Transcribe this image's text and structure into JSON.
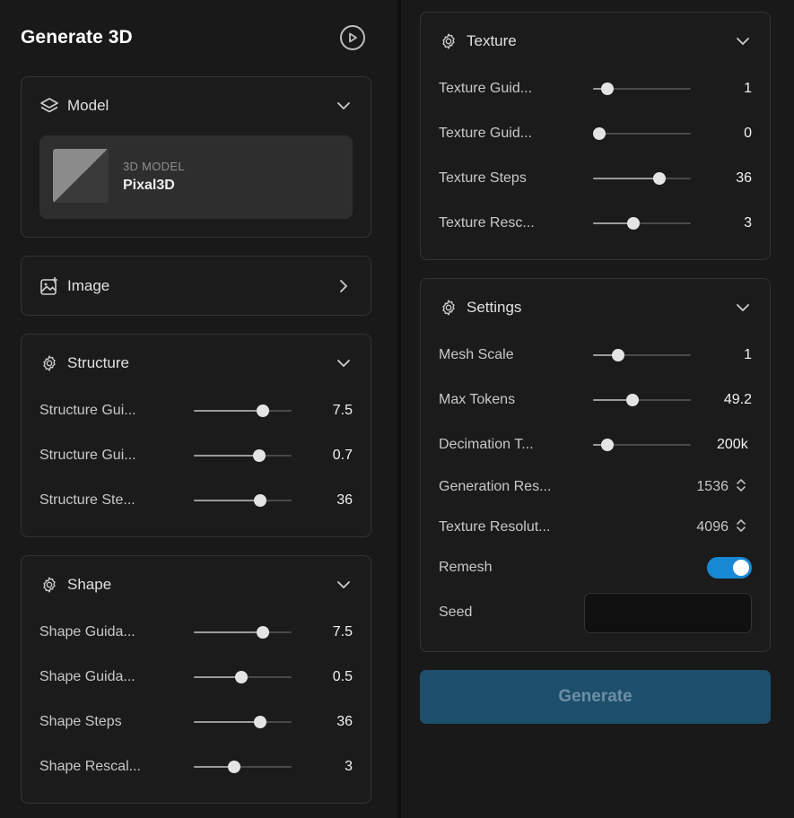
{
  "app": {
    "title": "Generate 3D"
  },
  "model": {
    "header": "Model",
    "card": {
      "caption": "3D MODEL",
      "name": "Pixal3D"
    }
  },
  "image": {
    "header": "Image"
  },
  "structure": {
    "header": "Structure",
    "rows": [
      {
        "label": "Structure Gui...",
        "value": "7.5",
        "fraction": 0.71
      },
      {
        "label": "Structure Gui...",
        "value": "0.7",
        "fraction": 0.67
      },
      {
        "label": "Structure Ste...",
        "value": "36",
        "fraction": 0.68
      }
    ]
  },
  "shape": {
    "header": "Shape",
    "rows": [
      {
        "label": "Shape Guida...",
        "value": "7.5",
        "fraction": 0.71
      },
      {
        "label": "Shape Guida...",
        "value": "0.5",
        "fraction": 0.49
      },
      {
        "label": "Shape Steps",
        "value": "36",
        "fraction": 0.68
      },
      {
        "label": "Shape Rescal...",
        "value": "3",
        "fraction": 0.41
      }
    ]
  },
  "texture": {
    "header": "Texture",
    "rows": [
      {
        "label": "Texture Guid...",
        "value": "1",
        "fraction": 0.15
      },
      {
        "label": "Texture Guid...",
        "value": "0",
        "fraction": 0.06
      },
      {
        "label": "Texture Steps",
        "value": "36",
        "fraction": 0.68
      },
      {
        "label": "Texture Resc...",
        "value": "3",
        "fraction": 0.41
      }
    ]
  },
  "settings": {
    "header": "Settings",
    "rows": [
      {
        "label": "Mesh Scale",
        "value": "1",
        "fraction": 0.26
      },
      {
        "label": "Max Tokens",
        "value": "49.2",
        "fraction": 0.4
      },
      {
        "label": "Decimation T...",
        "value": "200k",
        "fraction": 0.15
      }
    ],
    "generation_resolution": {
      "label": "Generation Res...",
      "value": "1536"
    },
    "texture_resolution": {
      "label": "Texture Resolut...",
      "value": "4096"
    },
    "remesh": {
      "label": "Remesh",
      "enabled": true
    },
    "seed": {
      "label": "Seed",
      "value": ""
    }
  },
  "actions": {
    "generate": "Generate"
  },
  "colors": {
    "accent": "#1688d4",
    "generate_bg": "#1d4f6c",
    "panel_border": "#333333"
  },
  "icons": {
    "play": "play-circle-icon",
    "model": "layers-icon",
    "image": "image-add-icon",
    "gear": "gear-icon",
    "chevron_down": "chevron-down-icon",
    "chevron_right": "chevron-right-icon",
    "stepper": "up-down-arrows-icon"
  }
}
